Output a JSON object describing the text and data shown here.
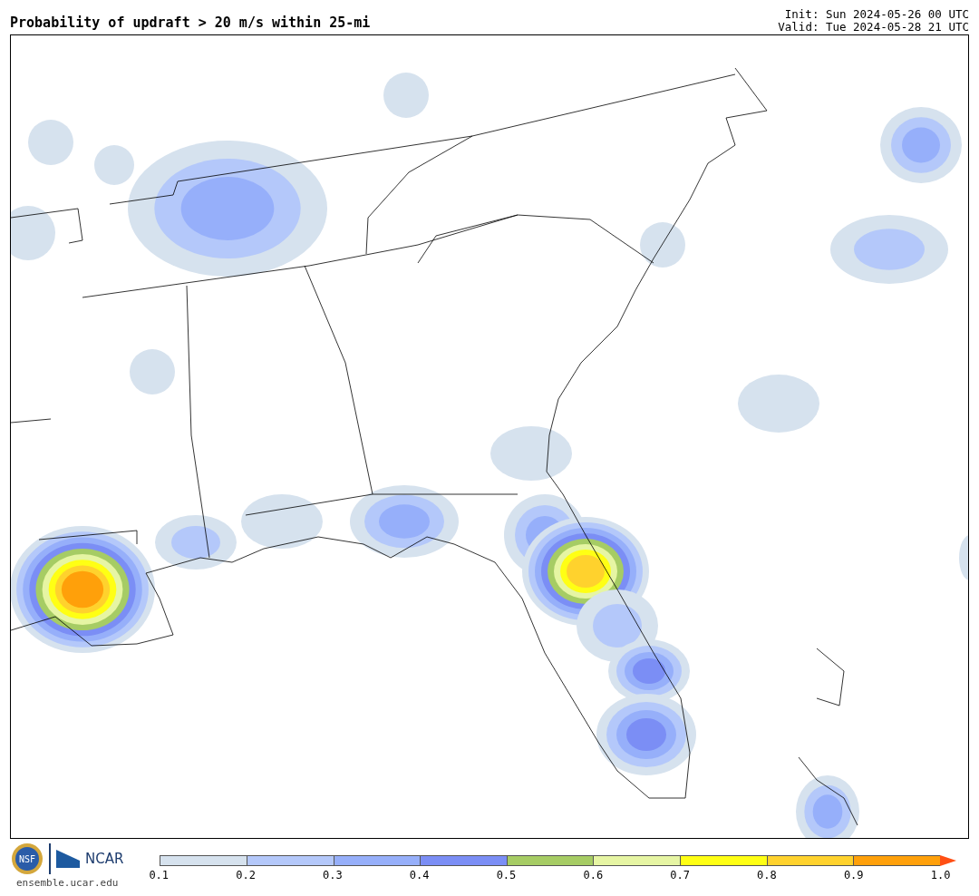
{
  "title": "Probability of updraft > 20 m/s within 25-mi",
  "run_info": [
    "Init: Sun 2024-05-26 00 UTC",
    "Valid: Tue 2024-05-28 21 UTC"
  ],
  "logos": {
    "nsf": "NSF",
    "ncar": "NCAR"
  },
  "site": "ensemble.ucar.edu",
  "colorbar": {
    "bins": [
      {
        "color": "#d6e2ee"
      },
      {
        "color": "#b4c8fa"
      },
      {
        "color": "#96affa"
      },
      {
        "color": "#7b8ef5"
      },
      {
        "color": "#a6cc64"
      },
      {
        "color": "#e6f5a3"
      },
      {
        "color": "#ffff14"
      },
      {
        "color": "#ffd22d"
      },
      {
        "color": "#ffa00a"
      }
    ],
    "extend": {
      "color": "#ff4f14"
    },
    "ticks": [
      "0.1",
      "0.2",
      "0.3",
      "0.4",
      "0.5",
      "0.6",
      "0.7",
      "0.8",
      "0.9",
      "1.0"
    ]
  }
}
